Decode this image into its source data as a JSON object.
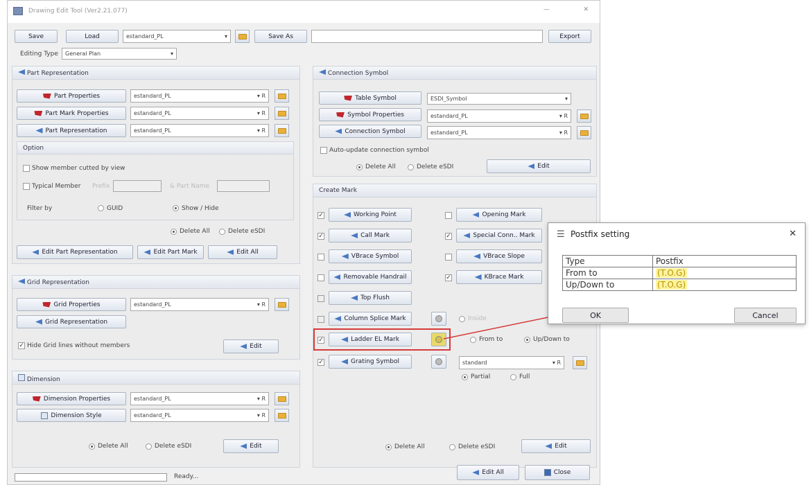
{
  "window": {
    "title": "Drawing Edit Tool (Ver2.21.077)",
    "minimize": "—",
    "close": "✕"
  },
  "toolbar": {
    "save": "Save",
    "load": "Load",
    "preset": "estandard_PL",
    "save_as": "Save As",
    "save_as_value": "",
    "export": "Export"
  },
  "editing_type": {
    "label": "Editing Type",
    "value": "General Plan"
  },
  "part_rep": {
    "title": "Part Representation",
    "rows": [
      {
        "label": "Part Properties",
        "value": "estandard_PL",
        "suffix": "R"
      },
      {
        "label": "Part Mark Properties",
        "value": "estandard_PL",
        "suffix": "R"
      },
      {
        "label": "Part Representation",
        "value": "estandard_PL",
        "suffix": "R"
      }
    ],
    "option_title": "Option",
    "show_member_cutted": "Show member cutted by view",
    "typical_member": "Typical Member",
    "prefix": "Prefix",
    "part_name": "& Part Name",
    "filter_by": "Filter by",
    "guid": "GUID",
    "show_hide": "Show / Hide",
    "delete_all": "Delete All",
    "delete_esdi": "Delete eSDI",
    "edit_part_rep": "Edit Part Representation",
    "edit_part_mark": "Edit Part Mark",
    "edit_all": "Edit All"
  },
  "grid_rep": {
    "title": "Grid Representation",
    "rows": [
      {
        "label": "Grid Properties",
        "value": "estandard_PL",
        "suffix": "R"
      }
    ],
    "grid_rep_button": "Grid Representation",
    "hide_grid_lines": "Hide Grid lines without members",
    "edit": "Edit"
  },
  "dimension": {
    "title": "Dimension",
    "rows": [
      {
        "label": "Dimension Properties",
        "value": "estandard_PL",
        "suffix": "R"
      },
      {
        "label": "Dimension Style",
        "value": "estandard_PL",
        "suffix": "R"
      }
    ],
    "delete_all": "Delete All",
    "delete_esdi": "Delete eSDI",
    "edit": "Edit"
  },
  "connection": {
    "title": "Connection Symbol",
    "rows": [
      {
        "label": "Table Symbol",
        "value": "ESDI_Symbol",
        "suffix": ""
      },
      {
        "label": "Symbol Properties",
        "value": "estandard_PL",
        "suffix": "R"
      },
      {
        "label": "Connection Symbol",
        "value": "estandard_PL",
        "suffix": "R"
      }
    ],
    "auto_update": "Auto-update connection symbol",
    "delete_all": "Delete All",
    "delete_esdi": "Delete eSDI",
    "edit": "Edit"
  },
  "create_mark": {
    "title": "Create Mark",
    "left": [
      {
        "label": "Working Point",
        "checked": "✓"
      },
      {
        "label": "Call Mark",
        "checked": "✓"
      },
      {
        "label": "VBrace Symbol",
        "checked": ""
      },
      {
        "label": "Removable Handrail",
        "checked": ""
      },
      {
        "label": "Top Flush",
        "checked": ""
      },
      {
        "label": "Column Splice Mark",
        "checked": ""
      },
      {
        "label": "Ladder EL Mark",
        "checked": "✓"
      },
      {
        "label": "Grating Symbol",
        "checked": "✓"
      }
    ],
    "right": [
      {
        "label": "Opening Mark",
        "checked": ""
      },
      {
        "label": "Special Conn.. Mark",
        "checked": "✓"
      },
      {
        "label": "VBrace Slope",
        "checked": ""
      },
      {
        "label": "KBrace Mark",
        "checked": "✓"
      }
    ],
    "inside": "Inside",
    "from_to": "From to",
    "up_down_to": "Up/Down to",
    "grating_value": "standard",
    "grating_suffix": "R",
    "partial": "Partial",
    "full": "Full",
    "delete_all": "Delete All",
    "delete_esdi": "Delete eSDI",
    "edit": "Edit"
  },
  "footer": {
    "status": "Ready...",
    "edit_all": "Edit All",
    "close": "Close"
  },
  "dialog": {
    "title": "Postfix setting",
    "close": "✕",
    "col_type": "Type",
    "col_postfix": "Postfix",
    "rows": [
      {
        "type": "From to",
        "postfix": "(T.O.G)"
      },
      {
        "type": "Up/Down to",
        "postfix": "(T.O.G)"
      }
    ],
    "ok": "OK",
    "cancel": "Cancel"
  },
  "colors": {
    "highlight": "#d63a3a",
    "yellow": "#fff3a0"
  }
}
